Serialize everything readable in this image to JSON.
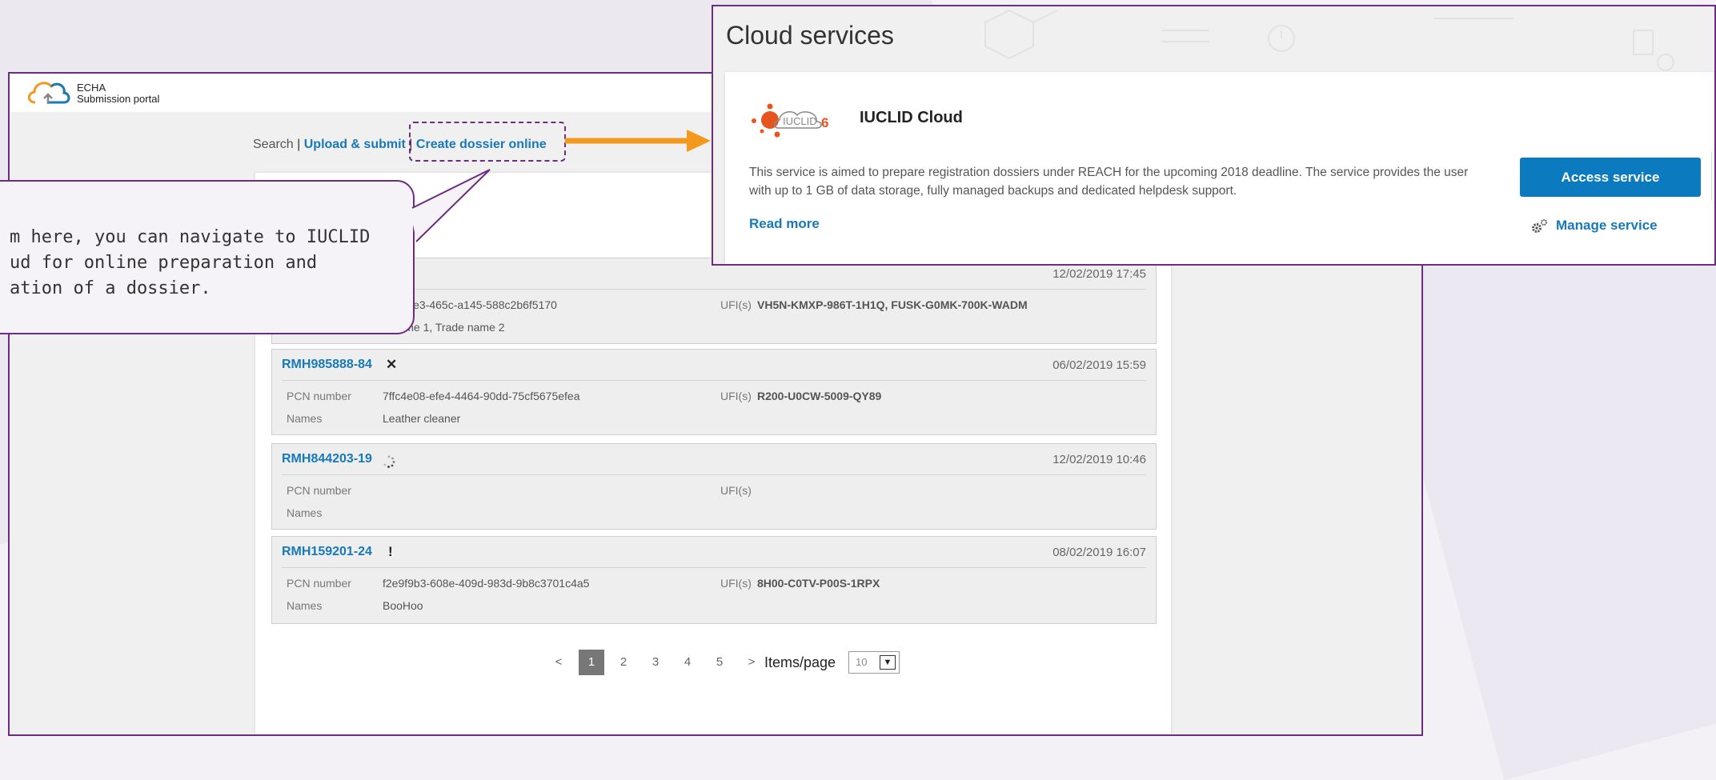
{
  "portal": {
    "logo_line1": "ECHA",
    "logo_line2": "Submission portal",
    "nav": {
      "search": "Search",
      "sep1": " | ",
      "upload": "Upload & submit",
      "sep2": " | ",
      "create": "Create dossier online"
    },
    "submissions": [
      {
        "id": "",
        "status_icon": "",
        "date": "12/02/2019 17:45",
        "pcn_label": "",
        "pcn": "cf5-3ce3-465c-a145-588c2b6f5170",
        "names_label": "",
        "names": "e name 1, Trade name 2",
        "ufi_label": "UFI(s)",
        "ufi": "VH5N-KMXP-986T-1H1Q, FUSK-G0MK-700K-WADM"
      },
      {
        "id": "RMH985888-84",
        "status_icon": "✕",
        "date": "06/02/2019 15:59",
        "pcn_label": "PCN number",
        "pcn": "7ffc4e08-efe4-4464-90dd-75cf5675efea",
        "names_label": "Names",
        "names": "Leather cleaner",
        "ufi_label": "UFI(s)",
        "ufi": "R200-U0CW-5009-QY89"
      },
      {
        "id": "RMH844203-19",
        "status_icon": "loading-spinner-icon",
        "date": "12/02/2019 10:46",
        "pcn_label": "PCN number",
        "pcn": "",
        "names_label": "Names",
        "names": "",
        "ufi_label": "UFI(s)",
        "ufi": ""
      },
      {
        "id": "RMH159201-24",
        "status_icon": "!",
        "date": "08/02/2019 16:07",
        "pcn_label": "PCN number",
        "pcn": "f2e9f9b3-608e-409d-983d-9b8c3701c4a5",
        "names_label": "Names",
        "names": "BooHoo",
        "ufi_label": "UFI(s)",
        "ufi": "8H00-C0TV-P00S-1RPX"
      }
    ],
    "pagination": {
      "prev": "<",
      "pages": [
        "1",
        "2",
        "3",
        "4",
        "5"
      ],
      "active_page": "1",
      "next": ">",
      "items_label": "Items/page",
      "items_value": "10"
    }
  },
  "callout": {
    "text": "m here, you can navigate to IUCLID\nud for online preparation and\nation of a dossier."
  },
  "cloud": {
    "title": "Cloud services",
    "logo_text": "IUCLID",
    "logo_version": "6",
    "service_name": "IUCLID Cloud",
    "description": "This service is aimed to prepare registration dossiers under REACH for the upcoming 2018 deadline. The service provides the user with up to 1 GB of data storage, fully managed backups and dedicated helpdesk support.",
    "read_more": "Read more",
    "access_button": "Access service",
    "manage_link": "Manage service"
  },
  "colors": {
    "accent_purple": "#6b2c82",
    "link_blue": "#1779ba",
    "button_blue": "#0c7abf",
    "arrow_orange": "#f39a1e"
  }
}
